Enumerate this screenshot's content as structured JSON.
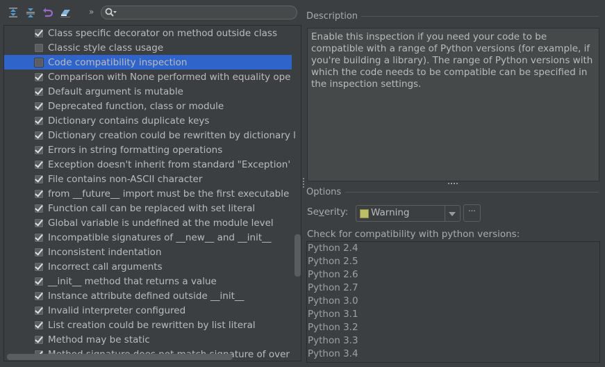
{
  "toolbar": {
    "icons": [
      "expand-all-icon",
      "collapse-all-icon",
      "reset-icon",
      "eraser-icon"
    ],
    "more_label": "»",
    "search_placeholder": ""
  },
  "tree": {
    "items": [
      {
        "label": "Class specific decorator on method outside class",
        "checked": true,
        "selected": false
      },
      {
        "label": "Classic style class usage",
        "checked": false,
        "selected": false
      },
      {
        "label": "Code compatibility inspection",
        "checked": false,
        "selected": true
      },
      {
        "label": "Comparison with None performed with equality ope",
        "checked": true,
        "selected": false
      },
      {
        "label": "Default argument is mutable",
        "checked": true,
        "selected": false
      },
      {
        "label": "Deprecated function, class or module",
        "checked": true,
        "selected": false
      },
      {
        "label": "Dictionary contains duplicate keys",
        "checked": true,
        "selected": false
      },
      {
        "label": "Dictionary creation could be rewritten by dictionary l",
        "checked": true,
        "selected": false
      },
      {
        "label": "Errors in string formatting operations",
        "checked": true,
        "selected": false
      },
      {
        "label": "Exception doesn't inherit from standard \"Exception'",
        "checked": true,
        "selected": false
      },
      {
        "label": "File contains non-ASCII character",
        "checked": true,
        "selected": false
      },
      {
        "label": "from __future__ import must be the first executable",
        "checked": true,
        "selected": false
      },
      {
        "label": "Function call can be replaced with set literal",
        "checked": true,
        "selected": false
      },
      {
        "label": "Global variable is undefined at the module level",
        "checked": true,
        "selected": false
      },
      {
        "label": "Incompatible signatures of __new__ and __init__",
        "checked": true,
        "selected": false
      },
      {
        "label": "Inconsistent indentation",
        "checked": true,
        "selected": false
      },
      {
        "label": "Incorrect call arguments",
        "checked": true,
        "selected": false
      },
      {
        "label": "__init__ method that returns a value",
        "checked": true,
        "selected": false
      },
      {
        "label": "Instance attribute defined outside __init__",
        "checked": true,
        "selected": false
      },
      {
        "label": "Invalid interpreter configured",
        "checked": true,
        "selected": false
      },
      {
        "label": "List creation could be rewritten by list literal",
        "checked": true,
        "selected": false
      },
      {
        "label": "Method may be static",
        "checked": true,
        "selected": false
      },
      {
        "label": "Method signature does not match signature of over",
        "checked": true,
        "selected": false
      }
    ]
  },
  "description": {
    "title": "Description",
    "text": "Enable this inspection if you need your code to be compatible with a range of Python versions (for example, if you're building a library). The range of Python versions with which the code needs to be compatible can be specified in the inspection settings."
  },
  "options": {
    "title": "Options",
    "severity_label_pre": "Se",
    "severity_label_mnemonic": "v",
    "severity_label_post": "erity:",
    "severity_value": "Warning",
    "severity_color": "#bebe62",
    "ellipsis_label": "···",
    "check_label": "Check for compatibility with python versions:",
    "versions": [
      "Python 2.4",
      "Python 2.5",
      "Python 2.6",
      "Python 2.7",
      "Python 3.0",
      "Python 3.1",
      "Python 3.2",
      "Python 3.3",
      "Python 3.4"
    ]
  }
}
